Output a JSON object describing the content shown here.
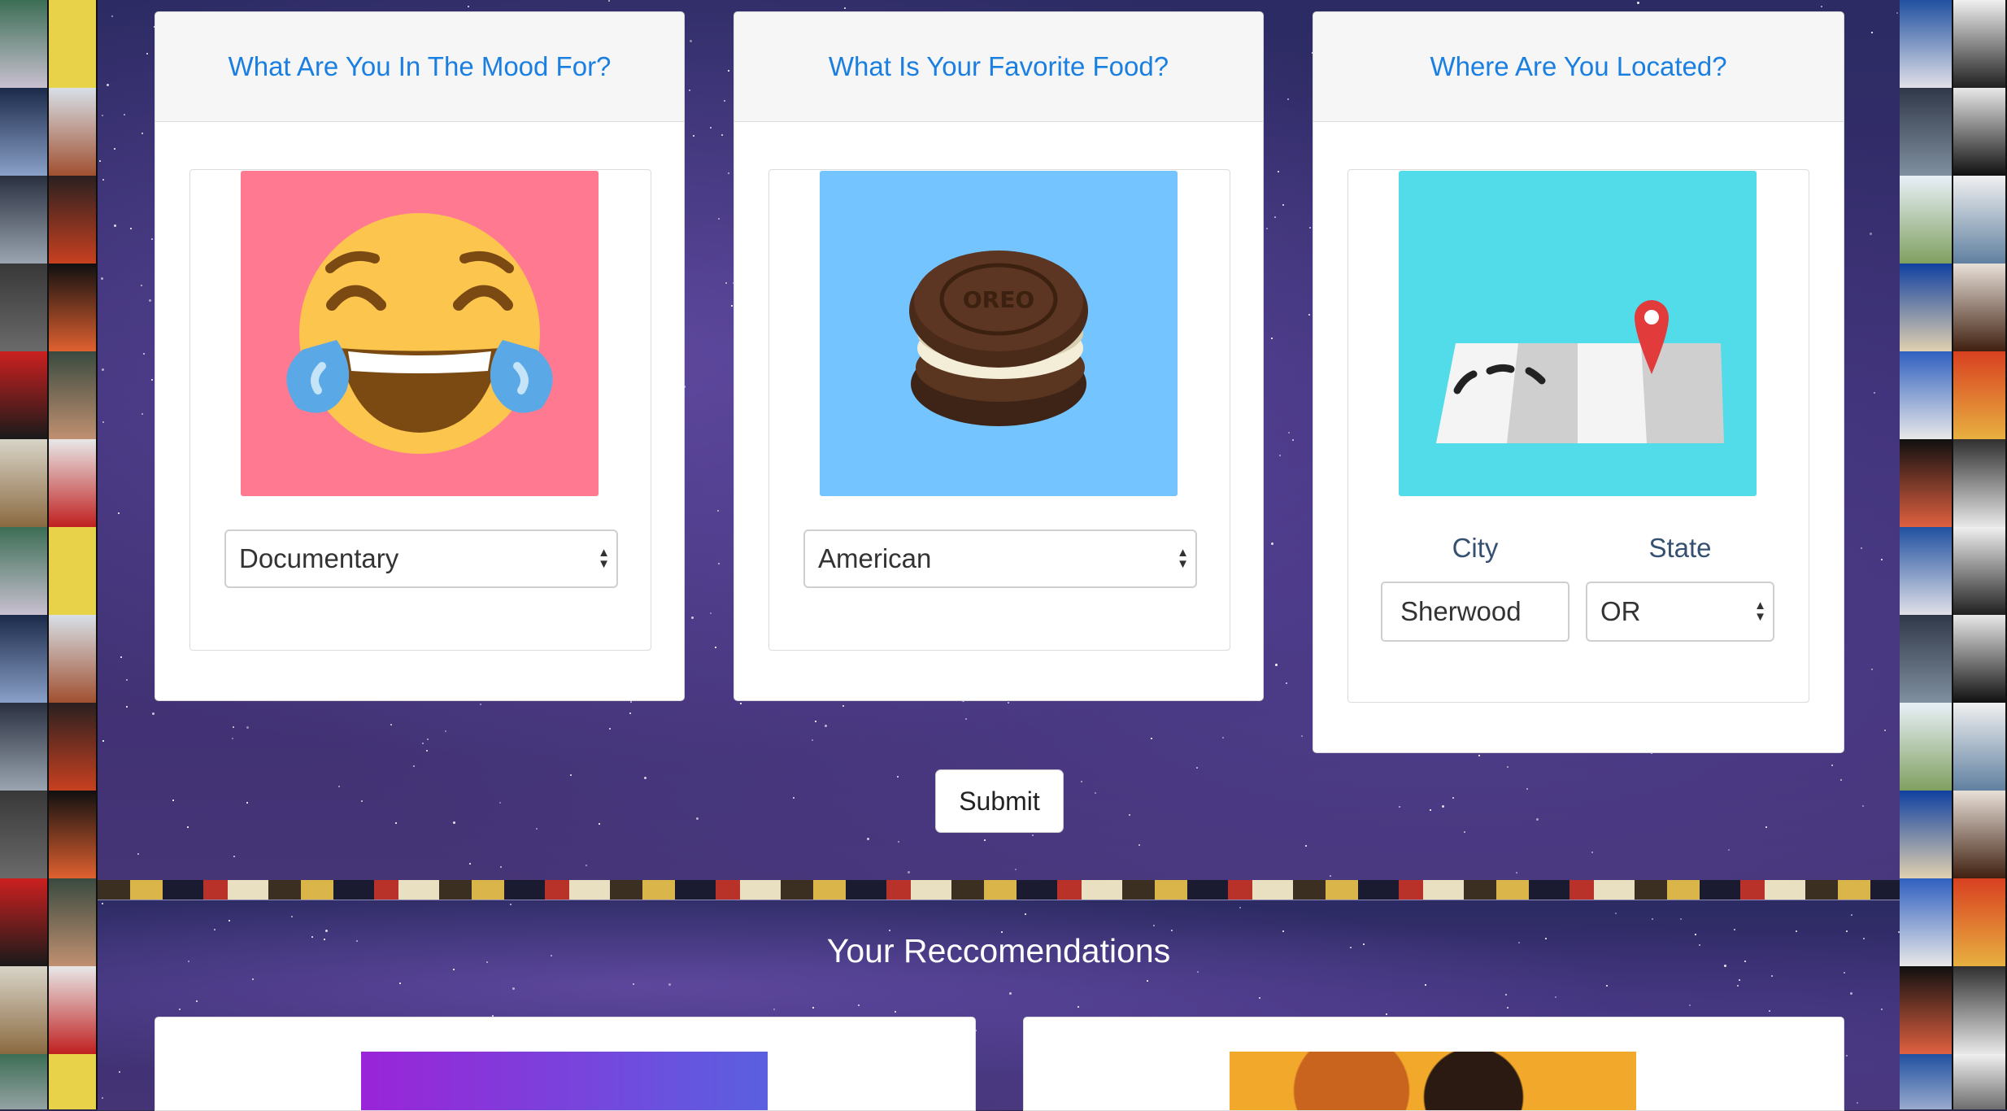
{
  "questions": {
    "mood": {
      "title": "What Are You In The Mood For?",
      "selected": "Documentary"
    },
    "food": {
      "title": "What Is Your Favorite Food?",
      "selected": "American"
    },
    "location": {
      "title": "Where Are You Located?",
      "city_label": "City",
      "state_label": "State",
      "city_value": "Sherwood",
      "state_selected": "OR"
    }
  },
  "submit_label": "Submit",
  "recommendations": {
    "title": "Your Reccomendations"
  },
  "icons": {
    "mood_image": "laughing-tears-emoji-icon",
    "food_image": "oreo-cookie-icon",
    "location_image": "map-pin-icon"
  },
  "colors": {
    "accent_text": "#1a7fe0",
    "mood_bg": "#ff7a90",
    "food_bg": "#74c5ff",
    "location_bg": "#52dbe8"
  }
}
